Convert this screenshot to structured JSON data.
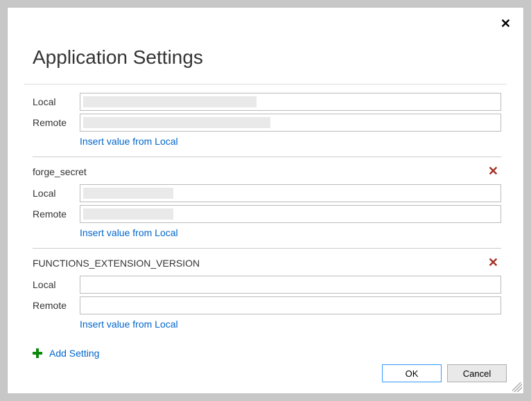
{
  "dialog": {
    "title": "Application Settings",
    "close_label": "✕"
  },
  "labels": {
    "local": "Local",
    "remote": "Remote",
    "insert_from_local": "Insert value from Local",
    "add_setting": "Add Setting",
    "ok": "OK",
    "cancel": "Cancel"
  },
  "settings": [
    {
      "name": "",
      "show_name": false,
      "deletable": false,
      "local_value": "",
      "remote_value": "",
      "local_redacted": true,
      "remote_redacted": true
    },
    {
      "name": "forge_secret",
      "show_name": true,
      "deletable": true,
      "local_value": "",
      "remote_value": "",
      "local_redacted": true,
      "remote_redacted": true
    },
    {
      "name": "FUNCTIONS_EXTENSION_VERSION",
      "show_name": true,
      "deletable": true,
      "local_value": "",
      "remote_value": "",
      "local_redacted": false,
      "remote_redacted": false
    }
  ]
}
